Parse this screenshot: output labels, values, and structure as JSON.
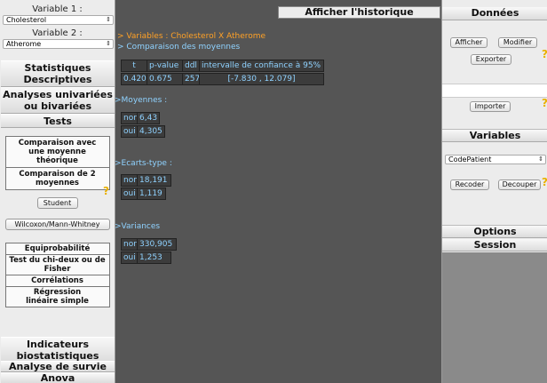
{
  "left": {
    "variable1_label": "Variable 1 :",
    "variable1_value": "Cholesterol",
    "variable2_label": "Variable 2 :",
    "variable2_value": "Atherome",
    "cat_stats_line1": "Statistiques",
    "cat_stats_line2": "Descriptives",
    "cat_univ_line1": "Analyses univariées",
    "cat_univ_line2": "ou bivariées",
    "cat_tests": "Tests",
    "test_comparaison_moyenne": "Comparaison avec une moyenne théorique",
    "test_comparaison_deux": "Comparaison de 2 moyennes",
    "student_label": "Student",
    "wilcoxon_label": "Wilcoxon/Mann-Whitney",
    "equiprobabilite": "Equiprobabilité",
    "chi_deux": "Test du chi-deux ou de Fisher",
    "correlations": "Corrélations",
    "regression": "Régression linéaire simple",
    "cat_indicateurs_line1": "Indicateurs",
    "cat_indicateurs_line2": "biostatistiques",
    "cat_survie": "Analyse de survie",
    "cat_anova": "Anova",
    "help_mark": "?"
  },
  "center": {
    "history_button": "Afficher l'historique",
    "variables_line": "> Variables : Cholesterol X Atherome",
    "comparison_line": "> Comparaison des moyennes",
    "result_table": {
      "headers": [
        "t",
        "p-value",
        "ddl",
        "intervalle de confiance à 95%"
      ],
      "values": [
        "0.420",
        "0.675",
        "257",
        "[-7.830 , 12.079]"
      ]
    },
    "moyennes_title": ">Moyennes :",
    "moyennes": [
      {
        "label": "non",
        "value": "6,43"
      },
      {
        "label": "oui",
        "value": "4,305"
      }
    ],
    "ecarts_title": ">Ecarts-type :",
    "ecarts": [
      {
        "label": "non",
        "value": "18,191"
      },
      {
        "label": "oui",
        "value": "1,119"
      }
    ],
    "variances_title": ">Variances",
    "variances": [
      {
        "label": "non",
        "value": "330,905"
      },
      {
        "label": "oui",
        "value": "1,253"
      }
    ]
  },
  "right": {
    "donnees_header": "Données",
    "afficher_button": "Afficher",
    "modifier_button": "Modifier",
    "exporter_button": "Exporter",
    "importer_button": "Importer",
    "variables_header": "Variables",
    "variable_select_value": "CodePatient",
    "recoder_button": "Recoder",
    "decouper_button": "Decouper",
    "options_header": "Options",
    "session_header": "Session",
    "help_mark": "?"
  },
  "colors": {
    "output_orange": "#ffa126",
    "output_blue": "#8fd2ff",
    "help_yellow": "#e9b100",
    "console_bg": "#555555",
    "panel_bg": "#ececec"
  }
}
